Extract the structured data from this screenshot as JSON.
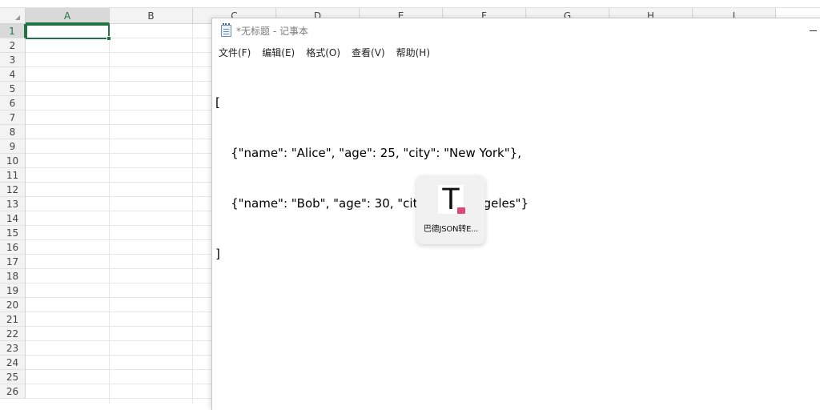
{
  "spreadsheet": {
    "columns": [
      "A",
      "B",
      "C",
      "D",
      "E",
      "F",
      "G",
      "H",
      "I"
    ],
    "rows": [
      "1",
      "2",
      "3",
      "4",
      "5",
      "6",
      "7",
      "8",
      "9",
      "10",
      "11",
      "12",
      "13",
      "14",
      "15",
      "16",
      "17",
      "18",
      "19",
      "20",
      "21",
      "22",
      "23",
      "24",
      "25",
      "26"
    ],
    "active_column": "A",
    "active_row": "1"
  },
  "notepad": {
    "title": "*无标题 - 记事本",
    "menu": [
      {
        "label": "文件(F)"
      },
      {
        "label": "编辑(E)"
      },
      {
        "label": "格式(O)"
      },
      {
        "label": "查看(V)"
      },
      {
        "label": "帮助(H)"
      }
    ],
    "content_lines": [
      "[",
      "    {\"name\": \"Alice\", \"age\": 25, \"city\": \"New York\"},",
      "    {\"name\": \"Bob\", \"age\": 30, \"city\": \"Los Angeles\"}",
      "]"
    ]
  },
  "app_icon": {
    "logo_letter": "T",
    "label": "巴德JSON转E...",
    "badge_color": "#e0457b"
  },
  "colors": {
    "excel_green": "#217346",
    "header_bg": "#f3f3f3"
  }
}
